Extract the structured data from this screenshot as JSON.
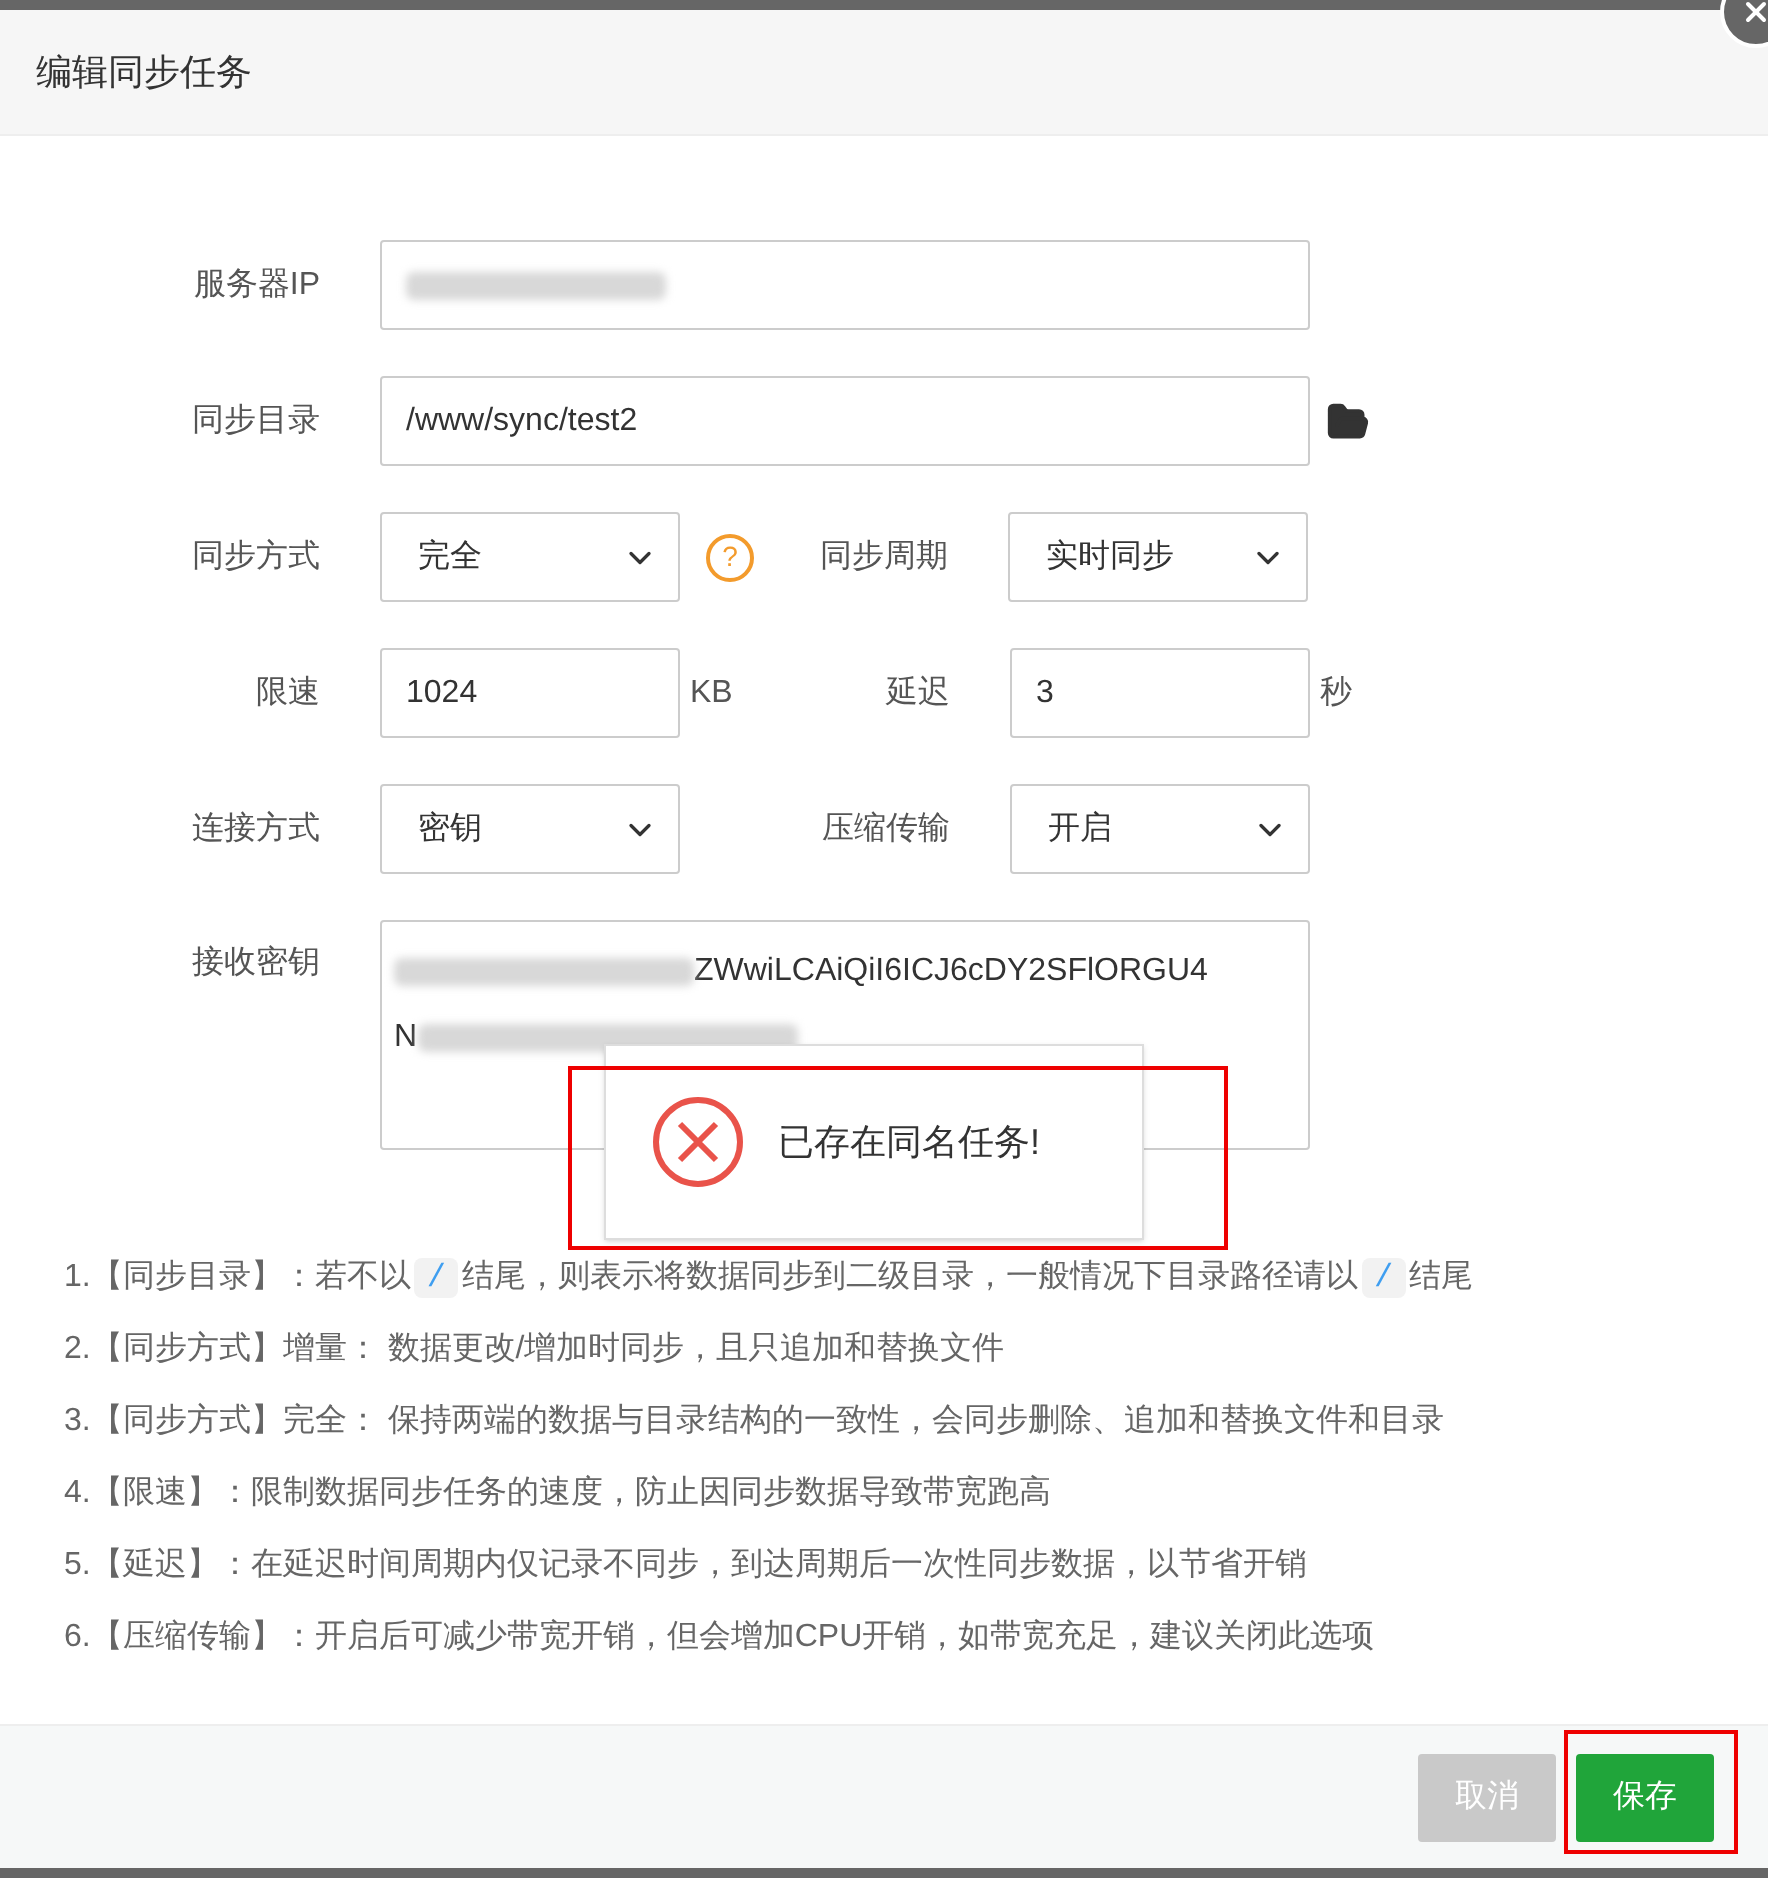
{
  "dialog": {
    "title": "编辑同步任务"
  },
  "form": {
    "server_ip": {
      "label": "服务器IP"
    },
    "sync_dir": {
      "label": "同步目录",
      "value": "/www/sync/test2"
    },
    "sync_mode": {
      "label": "同步方式",
      "value": "完全",
      "help": "?"
    },
    "sync_period": {
      "label": "同步周期",
      "value": "实时同步"
    },
    "speed_limit": {
      "label": "限速",
      "value": "1024",
      "unit": "KB"
    },
    "delay": {
      "label": "延迟",
      "value": "3",
      "unit": "秒"
    },
    "connect_mode": {
      "label": "连接方式",
      "value": "密钥"
    },
    "compress": {
      "label": "压缩传输",
      "value": "开启"
    },
    "receive_key": {
      "label": "接收密钥",
      "line1": "ZWwiLCAiQiI6ICJ6cDY2SFlORGU4",
      "line2": "N"
    }
  },
  "toast": {
    "message": "已存在同名任务!"
  },
  "notes": [
    {
      "parts": [
        {
          "kind": "text",
          "text": "1.【同步目录】：若不以"
        },
        {
          "kind": "code",
          "text": "/"
        },
        {
          "kind": "text",
          "text": "结尾，则表示将数据同步到二级目录，一般情况下目录路径请以"
        },
        {
          "kind": "code",
          "text": "/"
        },
        {
          "kind": "text",
          "text": "结尾"
        }
      ]
    },
    {
      "parts": [
        {
          "kind": "text",
          "text": "2.【同步方式】增量： 数据更改/增加时同步，且只追加和替换文件"
        }
      ]
    },
    {
      "parts": [
        {
          "kind": "text",
          "text": "3.【同步方式】完全： 保持两端的数据与目录结构的一致性，会同步删除、追加和替换文件和目录"
        }
      ]
    },
    {
      "parts": [
        {
          "kind": "text",
          "text": "4.【限速】：限制数据同步任务的速度，防止因同步数据导致带宽跑高"
        }
      ]
    },
    {
      "parts": [
        {
          "kind": "text",
          "text": "5.【延迟】：在延迟时间周期内仅记录不同步，到达周期后一次性同步数据，以节省开销"
        }
      ]
    },
    {
      "parts": [
        {
          "kind": "text",
          "text": "6.【压缩传输】：开启后可减少带宽开销，但会增加CPU开销，如带宽充足，建议关闭此选项"
        }
      ]
    }
  ],
  "buttons": [
    {
      "label": "取消",
      "kind": "cancel"
    },
    {
      "label": "保存",
      "kind": "save"
    }
  ]
}
